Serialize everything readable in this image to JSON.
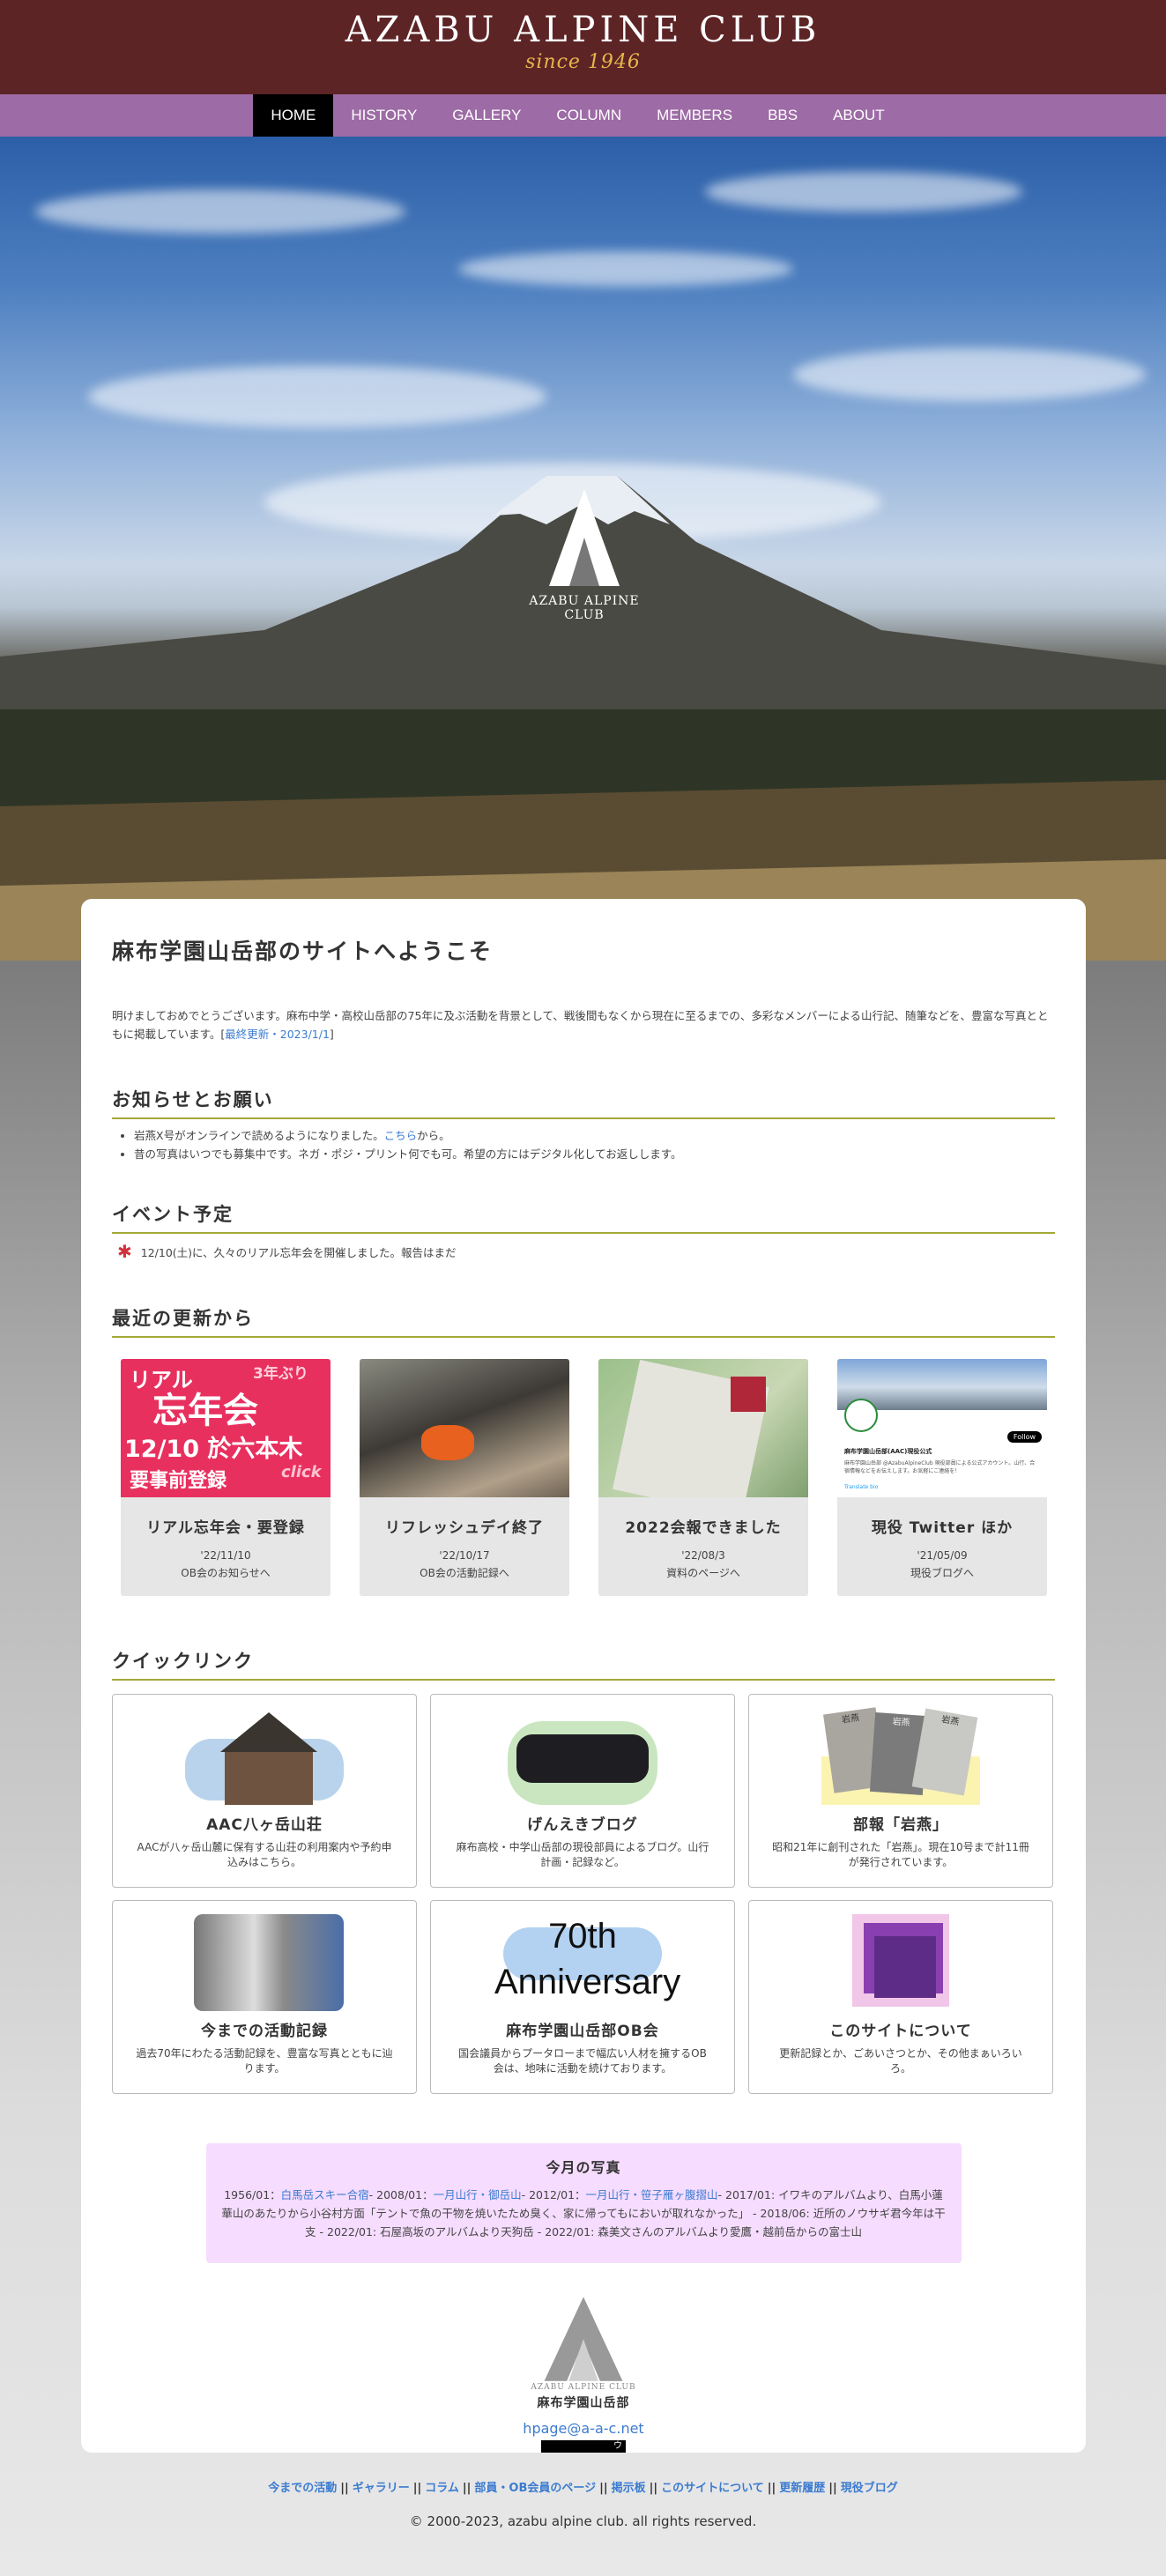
{
  "header": {
    "title": "AZABU ALPINE CLUB",
    "since": "since 1946"
  },
  "nav": [
    "HOME",
    "HISTORY",
    "GALLERY",
    "COLUMN",
    "MEMBERS",
    "BBS",
    "ABOUT"
  ],
  "hero": {
    "logo_text": "AZABU ALPINE CLUB"
  },
  "welcome": {
    "title": "麻布学園山岳部のサイトへようこそ",
    "intro": "明けましておめでとうございます。麻布中学・高校山岳部の75年に及ぶ活動を背景として、戦後間もなくから現在に至るまでの、多彩なメンバーによる山行記、随筆などを、豊富な写真とともに掲載しています。[",
    "intro_link": "最終更新・2023/1/1",
    "intro_end": "]"
  },
  "notices": {
    "title": "お知らせとお願い",
    "item1_pre": "岩燕X号がオンラインで読めるようになりました。",
    "item1_link": "こちら",
    "item1_post": "から。",
    "item2": "昔の写真はいつでも募集中です。ネガ・ポジ・プリント何でも可。希望の方にはデジタル化してお返しします。"
  },
  "events": {
    "title": "イベント予定",
    "item": "12/10(土)に、久々のリアル忘年会を開催しました。報告はまだ"
  },
  "updates": {
    "title": "最近の更新から",
    "items": [
      {
        "title": "リアル忘年会・要登録",
        "date": "'22/11/10",
        "desc": "OB会のお知らせへ",
        "thumb": {
          "l1": "3年ぶり",
          "l2": "リアル",
          "l3": "忘年会",
          "l4": "12/10 於六本木",
          "l5": "要事前登録",
          "l6": "click"
        }
      },
      {
        "title": "リフレッシュデイ終了",
        "date": "'22/10/17",
        "desc": "OB会の活動記録へ"
      },
      {
        "title": "2022会報できました",
        "date": "'22/08/3",
        "desc": "資料のページへ"
      },
      {
        "title": "現役 Twitter ほか",
        "date": "'21/05/09",
        "desc": "現役ブログへ",
        "thumb": {
          "name": "麻布学園山岳部(AAC)現役公式",
          "follow": "Follow",
          "bio": "麻布学園山岳部 @AzabuAlpineClub 現役部員による公式アカウント。山行、合宿情報などをお伝えします。お気軽にご連絡を！",
          "link": "Translate bio"
        }
      }
    ]
  },
  "quick": {
    "title": "クイックリンク",
    "items": [
      {
        "title": "AAC八ヶ岳山荘",
        "desc": "AACが八ヶ岳山麓に保有する山荘の利用案内や予約申込みはこちら。"
      },
      {
        "title": "げんえきブログ",
        "desc": "麻布高校・中学山岳部の現役部員によるブログ。山行計画・記録など。"
      },
      {
        "title": "部報「岩燕」",
        "desc": "昭和21年に創刊された「岩燕」。現在10号まで計11冊が発行されています。",
        "books": [
          "岩燕",
          "岩燕",
          "岩燕"
        ]
      },
      {
        "title": "今までの活動記録",
        "desc": "過去70年にわたる活動記録を、豊富な写真とともに辿ります。"
      },
      {
        "title": "麻布学園山岳部OB会",
        "desc": "国会議員からプータローまで幅広い人材を擁するOB 会は、地味に活動を続けております。",
        "art1": "70th",
        "art2": "Anniversary"
      },
      {
        "title": "このサイトについて",
        "desc": "更新記録とか、ごあいさつとか、その他まぁいろいろ。"
      }
    ]
  },
  "monthly": {
    "title": "今月の写真",
    "p1": "1956/01：",
    "l1": "白馬岳スキー合宿",
    "p2": "- 2008/01：",
    "l2": "一月山行・御岳山",
    "p3": "- 2012/01：",
    "l3": "一月山行・笹子雁ヶ腹摺山",
    "p4": "- 2017/01: イワキのアルバムより、白馬小蓮華山のあたりから小谷村方面「テントで魚の干物を焼いたため臭く、家に帰ってもにおいが取れなかった」 - 2018/06: 近所のノウサギ君今年は干支 - 2022/01: 石屋高坂のアルバムより天狗岳 - 2022/01: 森美文さんのアルバムより愛鷹・越前岳からの富士山"
  },
  "card_footer": {
    "logo_text": "AZABU ALPINE CLUB",
    "name": "麻布学園山岳部",
    "email": "hpage@a-a-c.net",
    "bar_glyph": "ウ"
  },
  "footer": {
    "links": [
      "今までの活動",
      "ギャラリー",
      "コラム",
      "部員・OB会員のページ",
      "掲示板",
      "このサイトについて",
      "更新履歴",
      "現役ブログ"
    ],
    "separator": "||",
    "copyright": "© 2000-2023, azabu alpine club. all rights reserved."
  }
}
